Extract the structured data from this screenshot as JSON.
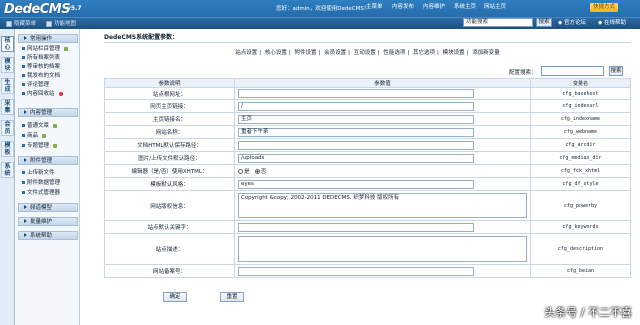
{
  "header": {
    "logo": "DedeCMS",
    "version": "v5.7",
    "welcome": "您好：admin，欢迎使用DedeCMS！",
    "nav": [
      "主菜单",
      "内容发布",
      "内容维护",
      "系统主页",
      "网站主页"
    ],
    "quick_button": "快捷方式",
    "sub_links": [
      "隐藏菜单",
      "功能地图"
    ],
    "search_value": "功能搜索",
    "search_button": "搜索",
    "official_forum": "官方论坛",
    "online_help": "在线帮助"
  },
  "left_tabs": [
    {
      "label": "核心",
      "active": true
    },
    {
      "label": "模块",
      "active": false
    },
    {
      "label": "生成",
      "active": false
    },
    {
      "label": "采集",
      "active": false
    },
    {
      "label": "会员",
      "active": false
    },
    {
      "label": "模板",
      "active": false
    },
    {
      "label": "系统",
      "active": false
    }
  ],
  "left_menu": {
    "groups": [
      {
        "title": "常用操作",
        "items": [
          {
            "label": "网站栏目管理",
            "icon": "add"
          },
          {
            "label": "所有档案列表",
            "icon": ""
          },
          {
            "label": "等审核的档案",
            "icon": ""
          },
          {
            "label": "我发布的文档",
            "icon": ""
          },
          {
            "label": "评论管理",
            "icon": ""
          },
          {
            "label": "内容回收站",
            "icon": "recycle"
          }
        ]
      },
      {
        "title": "内容管理",
        "items": [
          {
            "label": "普通文章",
            "icon": "add"
          },
          {
            "label": "商品",
            "icon": "add"
          },
          {
            "label": "专题管理",
            "icon": "add"
          }
        ]
      },
      {
        "title": "附件管理",
        "items": [
          {
            "label": "上传新文件",
            "icon": ""
          },
          {
            "label": "附件数据管理",
            "icon": ""
          },
          {
            "label": "文件式管理器",
            "icon": ""
          }
        ]
      },
      {
        "title": "频道模型",
        "items": []
      },
      {
        "title": "批量维护",
        "items": []
      },
      {
        "title": "系统帮助",
        "items": []
      }
    ]
  },
  "main": {
    "breadcrumb": "DedeCMS系统配置参数：",
    "tabs": [
      "站点设置",
      "核心设置",
      "附件设置",
      "会员设置",
      "互动设置",
      "性能选项",
      "其它选项",
      "模块设置",
      "添加新变量"
    ],
    "search_label": "配置搜索：",
    "search_value": "",
    "search_button": "搜索",
    "columns": [
      "参数说明",
      "参数值",
      "变量名"
    ],
    "rows": [
      {
        "label": "站点根网址：",
        "value": "",
        "var": "cfg_basehost",
        "type": "text"
      },
      {
        "label": "网页主页链接：",
        "value": "/",
        "var": "cfg_indexurl",
        "type": "text"
      },
      {
        "label": "主页链接名：",
        "value": "主页",
        "var": "cfg_indexname",
        "type": "text"
      },
      {
        "label": "网站名称：",
        "value": "重者下午茶",
        "var": "cfg_webname",
        "type": "text"
      },
      {
        "label": "文档HTML默认保存路径：",
        "value": "",
        "var": "cfg_arcdir",
        "type": "text"
      },
      {
        "label": "图片/上传文件默认路径：",
        "value": "/uploads",
        "var": "cfg_medias_dir",
        "type": "text"
      },
      {
        "label": "编辑器（是/否）使用XHTML：",
        "value": "",
        "var": "cfg_fck_xhtml",
        "type": "radio",
        "options": [
          "是",
          "否"
        ],
        "selected": 1
      },
      {
        "label": "模板默认风格：",
        "value": "eyes",
        "var": "cfg_df_style",
        "type": "text"
      },
      {
        "label": "网站版权信息：",
        "value": "Copyright &copy; 2002-2011 DEDECMS. 织梦科技 版权所有",
        "var": "cfg_powerby",
        "type": "textarea"
      },
      {
        "label": "站点默认关键字：",
        "value": "",
        "var": "cfg_keywords",
        "type": "text"
      },
      {
        "label": "站点描述：",
        "value": "",
        "var": "cfg_description",
        "type": "textarea"
      },
      {
        "label": "网站备案号：",
        "value": "",
        "var": "cfg_beian",
        "type": "text"
      }
    ],
    "confirm_button": "确定",
    "reset_button": "重置"
  },
  "watermark": "头条号 / 不二不喜"
}
